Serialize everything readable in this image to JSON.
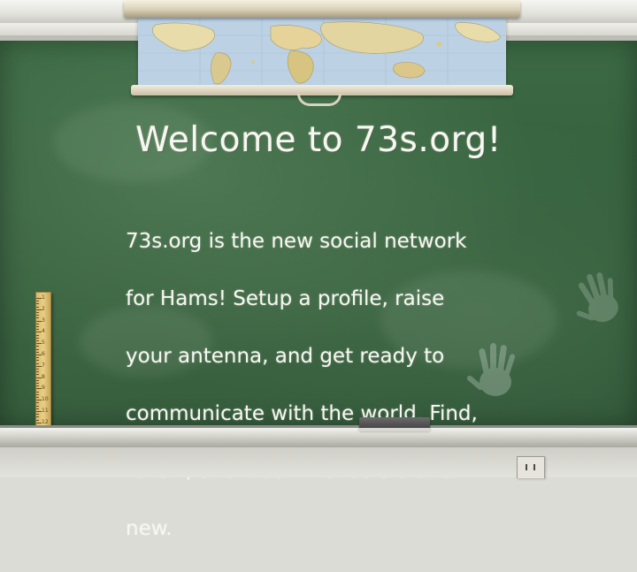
{
  "slide": {
    "title": "Welcome to 73s.org!",
    "body_lines": [
      "73s.org is the new social network",
      "for Hams!  Setup a profile, raise",
      "your antenna,  and get ready to",
      "communicate with the world.  Find,",
      "follow, and track friends old and",
      "new."
    ]
  },
  "colors": {
    "board": "#356040",
    "chalk": "#f7f7f0",
    "frame": "#b0b0a8",
    "ruler": "#e2c67e"
  },
  "ruler_numbers": [
    "1",
    "2",
    "3",
    "4",
    "5",
    "6",
    "7",
    "8",
    "9",
    "10",
    "11",
    "12"
  ]
}
